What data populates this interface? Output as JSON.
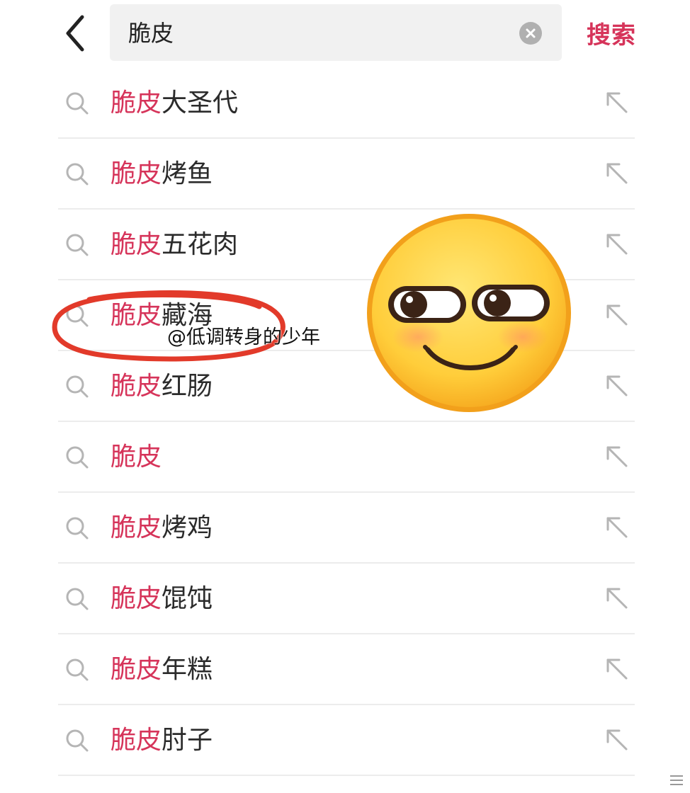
{
  "header": {
    "search_value": "脆皮",
    "search_button": "搜索"
  },
  "suggestions": [
    {
      "keyword": "脆皮",
      "rest": "大圣代"
    },
    {
      "keyword": "脆皮",
      "rest": "烤鱼"
    },
    {
      "keyword": "脆皮",
      "rest": "五花肉"
    },
    {
      "keyword": "脆皮",
      "rest": "藏海"
    },
    {
      "keyword": "脆皮",
      "rest": "红肠"
    },
    {
      "keyword": "脆皮",
      "rest": ""
    },
    {
      "keyword": "脆皮",
      "rest": "烤鸡"
    },
    {
      "keyword": "脆皮",
      "rest": "馄饨"
    },
    {
      "keyword": "脆皮",
      "rest": "年糕"
    },
    {
      "keyword": "脆皮",
      "rest": "肘子"
    }
  ],
  "overlay": {
    "watermark": "@低调转身的少年",
    "circle_color": "#e23a2a",
    "emoji": "smirking-face-emoji"
  },
  "colors": {
    "accent": "#d6345a",
    "text": "#2b2b2b",
    "icon": "#b5b5b5",
    "search_bg": "#f1f1f1"
  },
  "icons": [
    "back-arrow-icon",
    "clear-icon",
    "search-icon",
    "fill-arrow-icon"
  ]
}
